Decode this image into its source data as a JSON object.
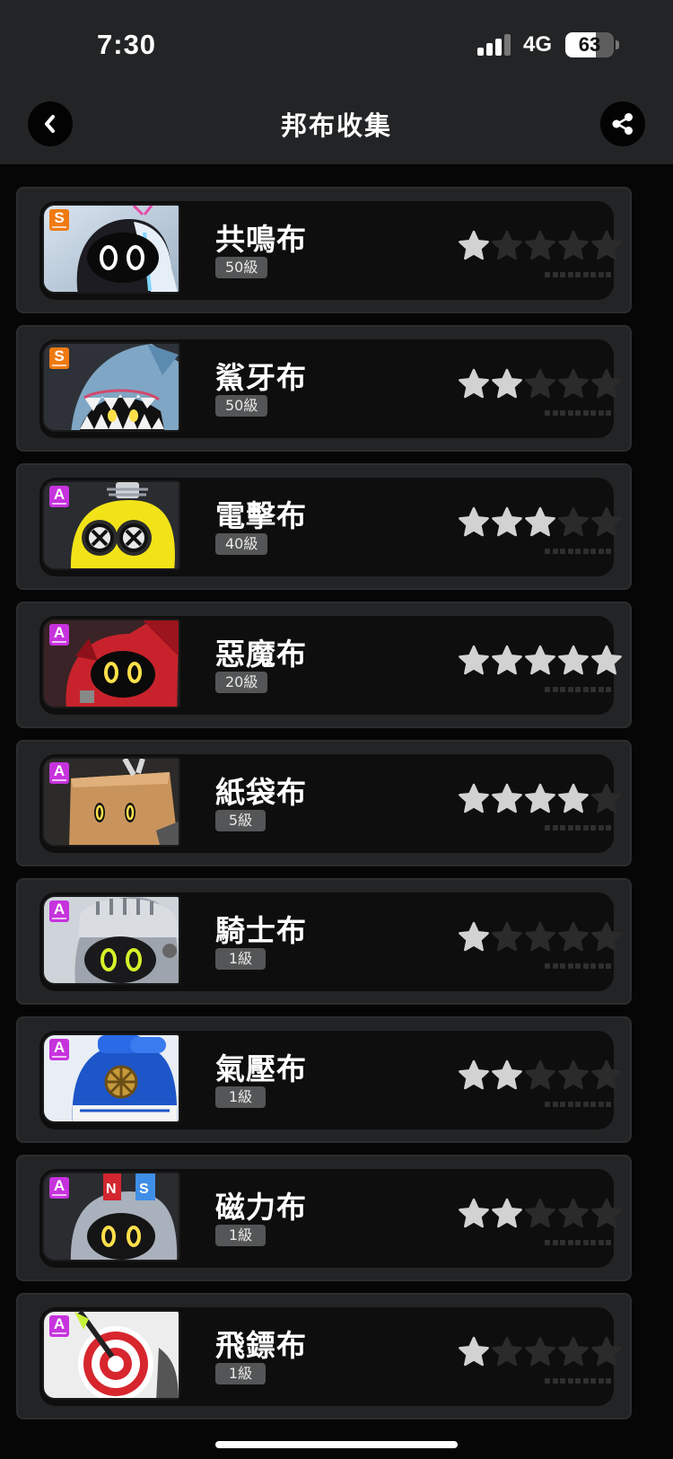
{
  "status_bar": {
    "time": "7:30",
    "network": "4G",
    "battery_percent": 63,
    "battery_label": "63",
    "signal_bars_active": 3
  },
  "header": {
    "title": "邦布收集",
    "back_icon": "chevron-left-icon",
    "share_icon": "share-icon"
  },
  "colors": {
    "background": "#060606",
    "bar": "#232425",
    "card": "#232425",
    "card_inner": "#0e0e0e",
    "star_active": "#d2d2d2",
    "star_inactive": "#2b2b2c",
    "rank_S": "#f07a12",
    "rank_A": "#c633dd",
    "level_badge": "#545556"
  },
  "bangboos": [
    {
      "name": "共鳴布",
      "level": "50級",
      "rank": "S",
      "stars": 1,
      "stars_max": 5,
      "portrait_icon": "bangboo-resonaboo-portrait"
    },
    {
      "name": "鯊牙布",
      "level": "50級",
      "rank": "S",
      "stars": 2,
      "stars_max": 5,
      "portrait_icon": "bangboo-sharkboo-portrait"
    },
    {
      "name": "電擊布",
      "level": "40級",
      "rank": "A",
      "stars": 3,
      "stars_max": 5,
      "portrait_icon": "bangboo-electroboo-portrait"
    },
    {
      "name": "惡魔布",
      "level": "20級",
      "rank": "A",
      "stars": 5,
      "stars_max": 5,
      "portrait_icon": "bangboo-devilboo-portrait"
    },
    {
      "name": "紙袋布",
      "level": "5級",
      "rank": "A",
      "stars": 4,
      "stars_max": 5,
      "portrait_icon": "bangboo-paperboo-portrait"
    },
    {
      "name": "騎士布",
      "level": "1級",
      "rank": "A",
      "stars": 1,
      "stars_max": 5,
      "portrait_icon": "bangboo-knightboo-portrait"
    },
    {
      "name": "氣壓布",
      "level": "1級",
      "rank": "A",
      "stars": 2,
      "stars_max": 5,
      "portrait_icon": "bangboo-pressurboo-portrait"
    },
    {
      "name": "磁力布",
      "level": "1級",
      "rank": "A",
      "stars": 2,
      "stars_max": 5,
      "portrait_icon": "bangboo-magnetiboo-portrait"
    },
    {
      "name": "飛鏢布",
      "level": "1級",
      "rank": "A",
      "stars": 1,
      "stars_max": 5,
      "portrait_icon": "bangboo-dartboo-portrait"
    }
  ]
}
